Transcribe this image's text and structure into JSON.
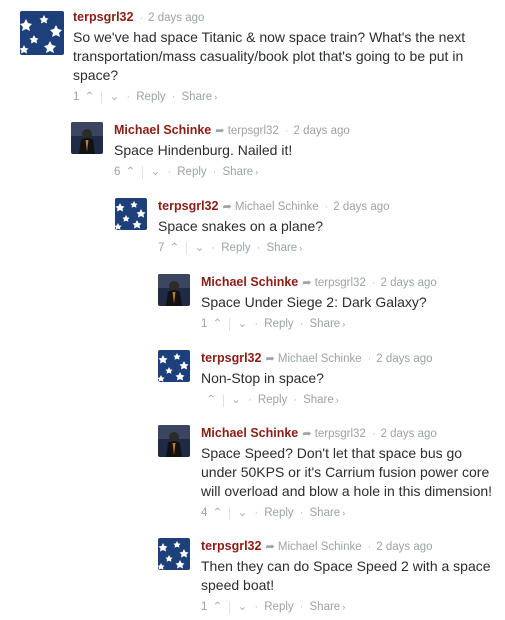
{
  "comments": [
    {
      "author": "terpsgrl32",
      "parent": "",
      "time": "2 days ago",
      "text": "So we've had space Titanic & now space train? What's the next transportation/mass casuality/book plot that's going to be put in space?",
      "upvotes": "1",
      "avatar": "stars-avatar",
      "reply_label": "Reply",
      "share_label": "Share"
    },
    {
      "author": "Michael Schinke",
      "parent": "terpsgrl32",
      "time": "2 days ago",
      "text": "Space Hindenburg. Nailed it!",
      "upvotes": "6",
      "avatar": "figure-avatar",
      "reply_label": "Reply",
      "share_label": "Share"
    },
    {
      "author": "terpsgrl32",
      "parent": "Michael Schinke",
      "time": "2 days ago",
      "text": "Space snakes on a plane?",
      "upvotes": "7",
      "avatar": "stars-avatar",
      "reply_label": "Reply",
      "share_label": "Share"
    },
    {
      "author": "Michael Schinke",
      "parent": "terpsgrl32",
      "time": "2 days ago",
      "text": "Space Under Siege 2: Dark Galaxy?",
      "upvotes": "1",
      "avatar": "figure-avatar",
      "reply_label": "Reply",
      "share_label": "Share"
    },
    {
      "author": "terpsgrl32",
      "parent": "Michael Schinke",
      "time": "2 days ago",
      "text": "Non-Stop in space?",
      "upvotes": "",
      "avatar": "stars-avatar",
      "reply_label": "Reply",
      "share_label": "Share"
    },
    {
      "author": "Michael Schinke",
      "parent": "terpsgrl32",
      "time": "2 days ago",
      "text": "Space Speed? Don't let that space bus go under 50KPS or it's Carrium fusion power core will overload and blow a hole in this dimension!",
      "upvotes": "4",
      "avatar": "figure-avatar",
      "reply_label": "Reply",
      "share_label": "Share"
    },
    {
      "author": "terpsgrl32",
      "parent": "Michael Schinke",
      "time": "2 days ago",
      "text": "Then they can do Space Speed 2 with a space speed boat!",
      "upvotes": "1",
      "avatar": "stars-avatar",
      "reply_label": "Reply",
      "share_label": "Share"
    }
  ],
  "colors": {
    "author": "#8c1c13",
    "meta": "#9aa3a7",
    "text": "#2a2e2e",
    "stars_avatar_bg": "#1d3f7a",
    "figure_avatar_bg": "#1f2a44"
  }
}
